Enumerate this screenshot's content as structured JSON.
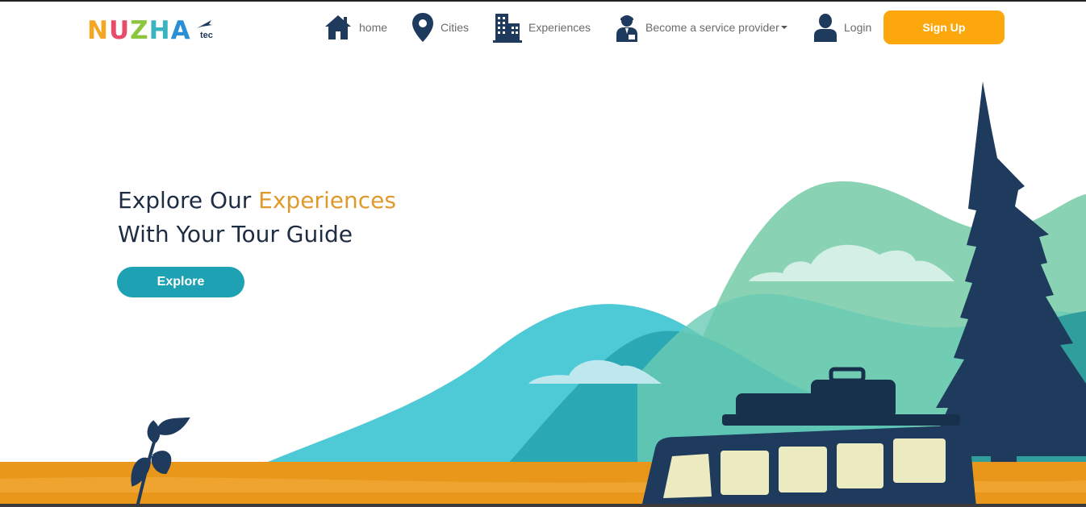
{
  "brand": {
    "logo_text": "NUZHA",
    "logo_suffix": "tec"
  },
  "nav": {
    "home": "home",
    "cities": "Cities",
    "experiences": "Experiences",
    "service_provider": "Become a service provider",
    "login": "Login",
    "signup": "Sign Up"
  },
  "hero": {
    "line1_prefix": "Explore Our ",
    "line1_accent": "Experiences",
    "line2": "With Your Tour Guide",
    "cta": "Explore"
  },
  "colors": {
    "accent_orange": "#fca80d",
    "heading_accent": "#e09a2c",
    "cta_teal": "#1ea2b3",
    "navy": "#1e3a5c"
  },
  "icons": {
    "home": "home-icon",
    "cities": "map-pin-icon",
    "experiences": "building-icon",
    "service_provider": "agent-icon",
    "login": "user-icon"
  }
}
